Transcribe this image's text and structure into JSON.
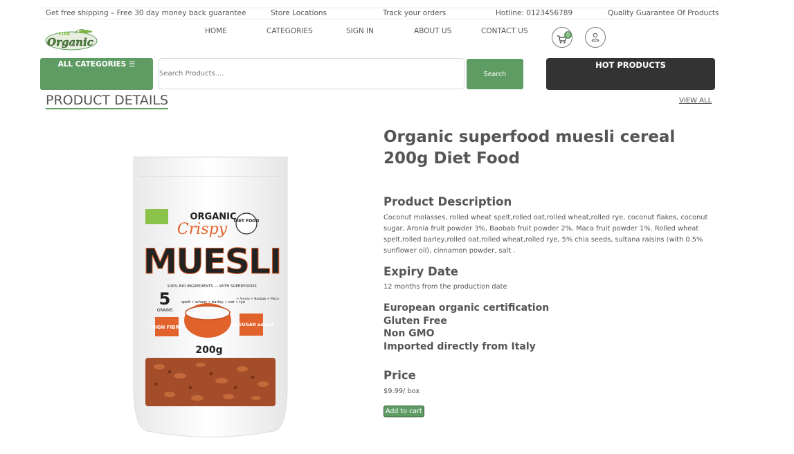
{
  "topbar": {
    "shipping": "Get free shipping – Free 30 day money back guarantee",
    "store_locations": "Store Locations",
    "track_orders": "Track your orders",
    "hotline": "Hotline: 0123456789",
    "quality": "Quality Guarantee Of Products"
  },
  "logo": {
    "top_text": "STAR",
    "main_text": "Organic"
  },
  "nav": [
    "HOME",
    "CATEGORIES",
    "SIGN IN",
    "ABOUT US",
    "CONTACT US"
  ],
  "cart": {
    "count": "0",
    "icon": "cart-icon"
  },
  "user": {
    "icon": "user-icon"
  },
  "all_categories": {
    "label": "ALL CATEGORIES ☰"
  },
  "search": {
    "placeholder": "Search Products....",
    "button_label": "Search"
  },
  "hot_products": {
    "label": "HOT PRODUCTS"
  },
  "section": {
    "title": "PRODUCT DETAILS",
    "view_all": "VIEW ALL"
  },
  "product": {
    "image_text": {
      "organic": "ORGANIC",
      "crispy": "Crispy",
      "muesli": "MUESLI",
      "diet_food": "DIET FOOD",
      "ingredients": "100% BIO INGREDIENTS — WITH SUPERFOODS",
      "grains_number": "5",
      "grains": "GRAINS",
      "grain_list": "spelt • wheat • barley • oat • rye",
      "extras": "+ Aronia + Baobab + Maca",
      "high_fibre": "HIGH FIBRE",
      "no_sugar": "NO SUGAR added",
      "weight": "200g"
    },
    "title": "Organic superfood muesli cereal 200g Diet Food",
    "description_heading": "Product Description",
    "description": "Coconut molasses, rolled wheat spelt,rolled oat,rolled wheat,rolled rye, coconut flakes, coconut sugar, Aronia fruit powder 3%, Baobab fruit powder 2%, Maca fruit powder 1%. Rolled wheat spelt,rolled barley,rolled oat,rolled wheat,rolled rye, 5% chia seeds, sultana raisins (with 0.5% sunflower oil), cinnamon powder, salt .",
    "expiry_heading": "Expiry Date",
    "expiry": "12 months from the production date",
    "certifications": [
      "European organic certification",
      "Gluten Free",
      "Non GMO",
      "Imported directly from Italy"
    ],
    "price_heading": "Price",
    "price": "$9.99/ box",
    "add_to_cart": "Add to cart"
  },
  "colors": {
    "accent": "#5f9c63",
    "dark": "#333333",
    "text": "#555555"
  }
}
